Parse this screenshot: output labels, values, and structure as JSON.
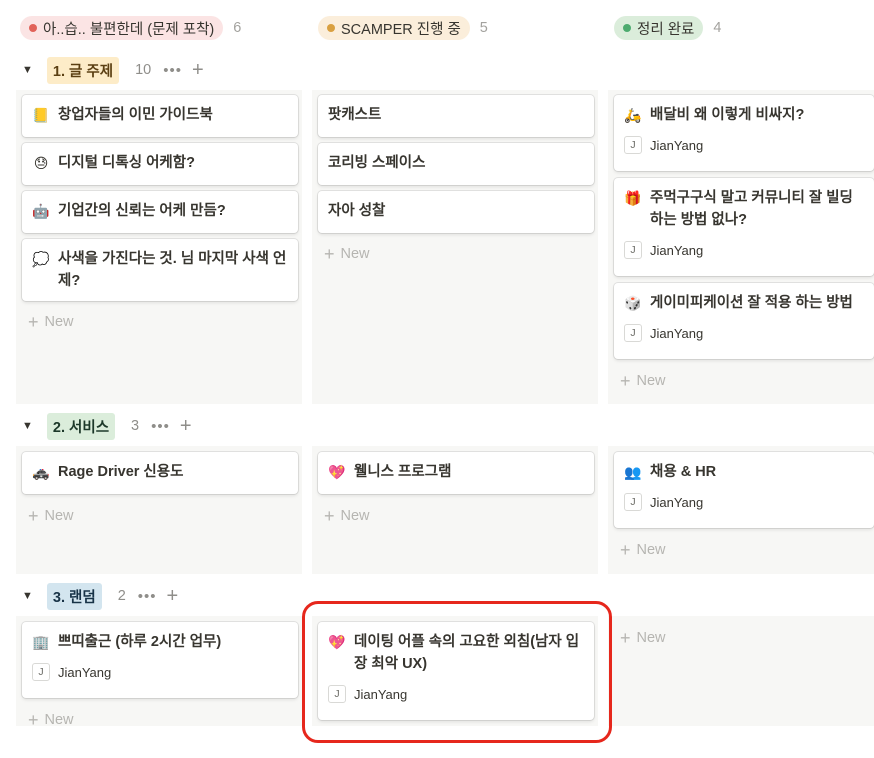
{
  "columns": [
    {
      "label": "아..습.. 불편한데 (문제 포착)",
      "count": "6",
      "pill_bg": "#fbe4e4",
      "dot": "#e16259"
    },
    {
      "label": "SCAMPER 진행 중",
      "count": "5",
      "pill_bg": "#fbeedb",
      "dot": "#d9a040"
    },
    {
      "label": "정리 완료",
      "count": "4",
      "pill_bg": "#dbeddb",
      "dot": "#4dab6f"
    }
  ],
  "groups": [
    {
      "label": "1. 글 주제",
      "count": "10",
      "tag_bg": "#fdecc8",
      "tag_color": "#5b3f12"
    },
    {
      "label": "2. 서비스",
      "count": "3",
      "tag_bg": "#dbeddb",
      "tag_color": "#1c3829"
    },
    {
      "label": "3. 랜덤",
      "count": "2",
      "tag_bg": "#d3e5ef",
      "tag_color": "#183347"
    }
  ],
  "cards": {
    "g1_c1": [
      {
        "icon": "📒",
        "title": "창업자들의 이민 가이드북"
      },
      {
        "icon": "😓",
        "title": "디지털 디톡싱 어케함?"
      },
      {
        "icon": "🤖",
        "title": "기업간의 신뢰는 어케 만듬?"
      },
      {
        "icon": "💭",
        "title": "사색을 가진다는 것. 님 마지막 사색 언제?"
      }
    ],
    "g1_c2": [
      {
        "icon": "",
        "title": "팟캐스트"
      },
      {
        "icon": "",
        "title": "코리빙 스페이스"
      },
      {
        "icon": "",
        "title": "자아 성찰"
      }
    ],
    "g1_c3": [
      {
        "icon": "🛵",
        "title": "배달비 왜 이렇게 비싸지?",
        "person": "JianYang"
      },
      {
        "icon": "🎁",
        "title": "주먹구구식 말고 커뮤니티 잘 빌딩하는 방법 없나?",
        "person": "JianYang"
      },
      {
        "icon": "🎲",
        "title": "게이미피케이션 잘 적용 하는 방법",
        "person": "JianYang"
      }
    ],
    "g2_c1": [
      {
        "icon": "🚓",
        "title": "Rage Driver 신용도"
      }
    ],
    "g2_c2": [
      {
        "icon": "💖",
        "title": "웰니스 프로그램"
      }
    ],
    "g2_c3": [
      {
        "icon": "👥",
        "title": "채용 & HR",
        "person": "JianYang"
      }
    ],
    "g3_c1": [
      {
        "icon": "🏢",
        "title": "쁘띠출근 (하루 2시간 업무)",
        "person": "JianYang"
      }
    ],
    "g3_c2": [
      {
        "icon": "💖",
        "title": "데이팅 어플 속의 고요한 외침(남자 입장 최악 UX)",
        "person": "JianYang"
      }
    ]
  },
  "avatar_initial": "J",
  "new_label": "New",
  "icons": {
    "group_toggle": "triangle-down-icon",
    "more": "more-icon",
    "add": "plus-icon"
  }
}
